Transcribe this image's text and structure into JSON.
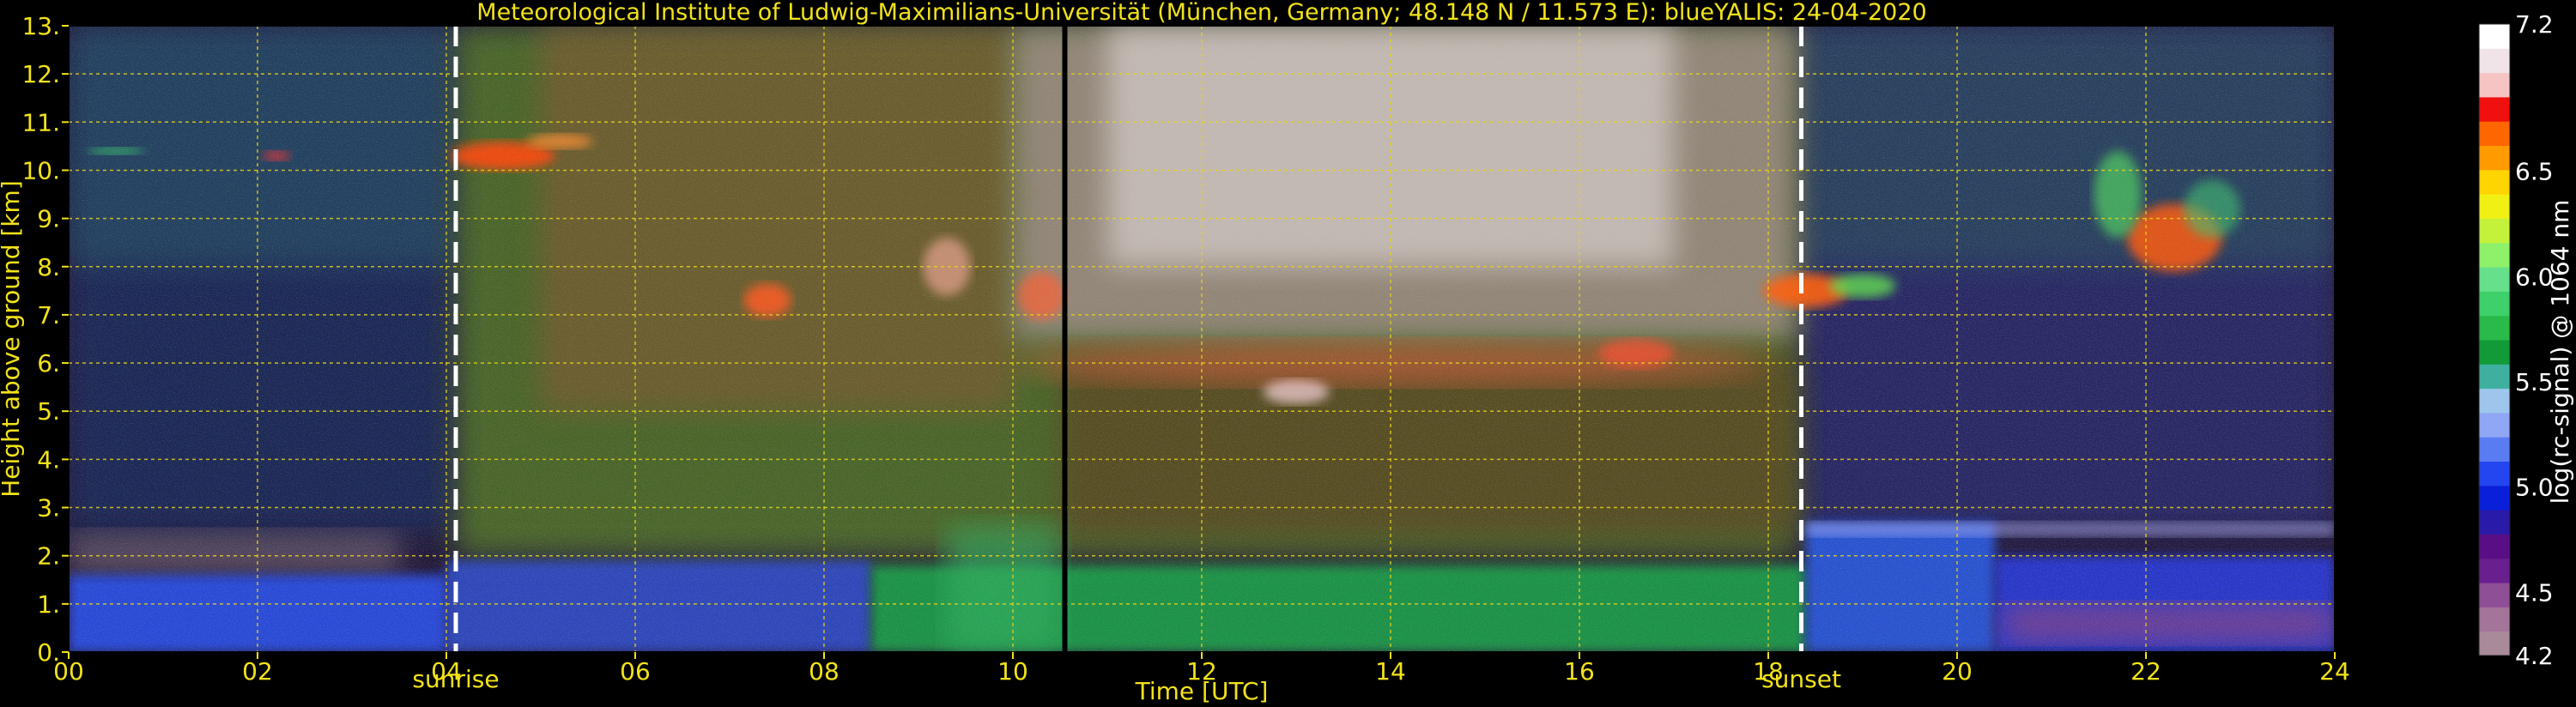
{
  "chart_data": {
    "type": "heatmap",
    "title": "Meteorological Institute of Ludwig-Maximilians-Universität (München, Germany; 48.148 N / 11.573 E):     blueYALIS: 24-04-2020",
    "xlabel": "Time [UTC]",
    "ylabel": "Height above ground [km]",
    "xlim": [
      0,
      24
    ],
    "ylim": [
      0,
      13
    ],
    "x_ticks": [
      "00",
      "02",
      "04",
      "06",
      "08",
      "10",
      "12",
      "14",
      "16",
      "18",
      "20",
      "22",
      "24"
    ],
    "y_ticks": [
      "0.",
      "1.",
      "2.",
      "3.",
      "4.",
      "5.",
      "6.",
      "7.",
      "8.",
      "9.",
      "10.",
      "11.",
      "12.",
      "13."
    ],
    "grid": true,
    "colorbar": {
      "label": "log(rc-signal) @ 1064 nm",
      "range": [
        4.2,
        7.2
      ],
      "ticks": [
        "7.2",
        "6.5",
        "6.0",
        "5.5",
        "5.0",
        "4.5",
        "4.2"
      ],
      "colors": [
        "#a98a9a",
        "#a4749a",
        "#8e4f96",
        "#6a1f8f",
        "#5a0e86",
        "#2a1aa8",
        "#0a1fd8",
        "#2346f0",
        "#5a7cf2",
        "#8fa7f4",
        "#9ec6ec",
        "#3fb0a0",
        "#139a38",
        "#2aba4a",
        "#3ed06a",
        "#66e08a",
        "#8ff06a",
        "#c4f23a",
        "#f0f014",
        "#ffd400",
        "#ff9a00",
        "#ff6600",
        "#f01010",
        "#f7c4c4",
        "#f0e4e8",
        "#ffffff"
      ]
    },
    "vertical_markers": [
      {
        "x": 4.1,
        "label": "sunrise",
        "style": "dashed"
      },
      {
        "x": 18.35,
        "label": "sunset",
        "style": "dashed"
      },
      {
        "x": 10.55,
        "label": "",
        "style": "solid"
      }
    ],
    "colors": {
      "text": "#f2e21a",
      "grid": "#e6d21a",
      "background": "#000000"
    }
  }
}
